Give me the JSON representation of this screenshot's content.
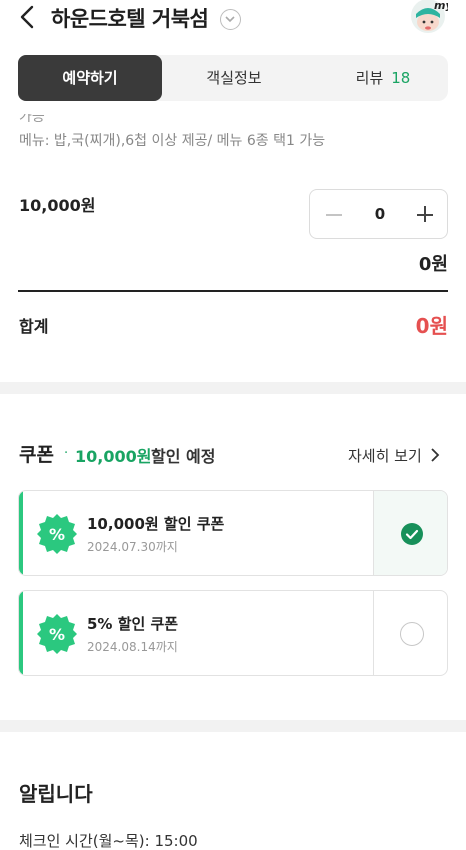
{
  "header": {
    "title": "하운드호텔 거북섬",
    "avatar_badge": "my",
    "back_icon": "chevron-left-icon",
    "title_chevron_icon": "chevron-down-circle-icon"
  },
  "tabs": [
    {
      "label": "예약하기",
      "active": true
    },
    {
      "label": "객실정보",
      "active": false
    },
    {
      "label": "리뷰",
      "count": "18",
      "active": false
    }
  ],
  "menu": {
    "cut_text": "가능",
    "description": "메뉴: 밥,국(찌개),6첩 이상 제공/ 메뉴 6종 택1 가능",
    "price": "10,000원",
    "quantity": "0",
    "subtotal": "0원"
  },
  "total": {
    "label": "합계",
    "value": "0원"
  },
  "coupon_section": {
    "title": "쿠폰",
    "separator": "·",
    "discount_amount": "10,000원",
    "discount_suffix": "할인 예정",
    "more_label": "자세히 보기"
  },
  "coupons": [
    {
      "name": "10,000원 할인 쿠폰",
      "expiry": "2024.07.30까지",
      "selected": true,
      "badge_text": "%"
    },
    {
      "name": "5% 할인 쿠폰",
      "expiry": "2024.08.14까지",
      "selected": false,
      "badge_text": "%"
    }
  ],
  "notice": {
    "title": "알립니다",
    "lines": [
      "체크인 시간(월~목): 15:00"
    ]
  },
  "colors": {
    "accent_green": "#19a463",
    "badge_green": "#2bc87f",
    "total_red": "#e55050",
    "tab_active_bg": "#3a3a3a"
  }
}
